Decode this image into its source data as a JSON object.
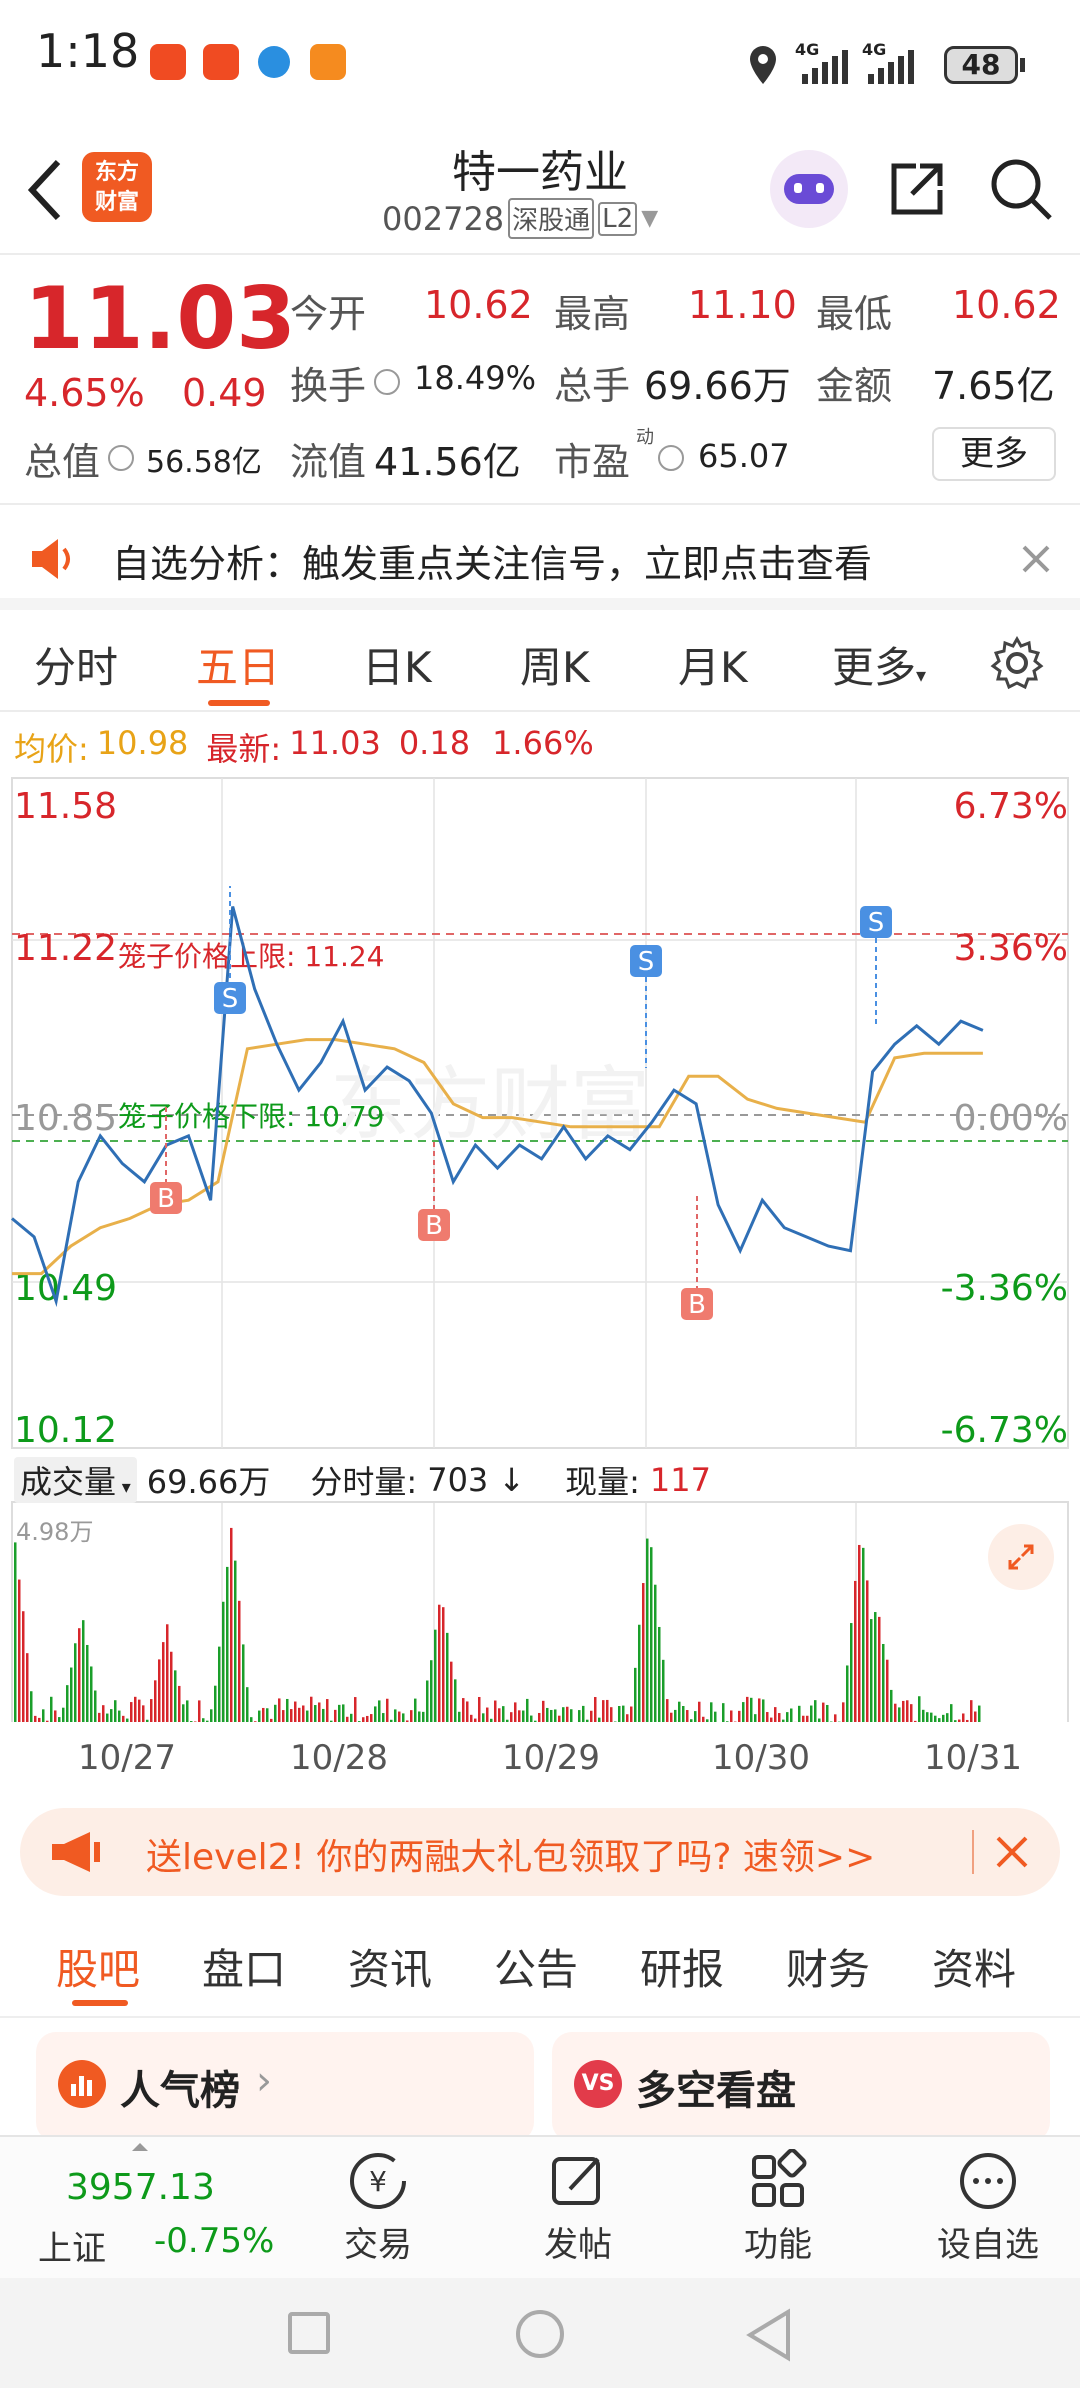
{
  "status": {
    "time": "1:18",
    "battery": "48",
    "net1": "4G",
    "net2": "4G"
  },
  "nav": {
    "title": "特一药业",
    "code": "002728",
    "badge": "深股通",
    "level": "L2",
    "logo_line1": "东方",
    "logo_line2": "财富"
  },
  "quote": {
    "price": "11.03",
    "pct": "4.65%",
    "chg": "0.49",
    "open_l": "今开",
    "open": "10.62",
    "high_l": "最高",
    "high": "11.10",
    "low_l": "最低",
    "low": "10.62",
    "turn_l": "换手",
    "turn": "18.49%",
    "vol_l": "总手",
    "vol": "69.66万",
    "amt_l": "金额",
    "amt": "7.65亿",
    "mcap_l": "总值",
    "mcap": "56.58亿",
    "float_l": "流值",
    "float": "41.56亿",
    "pe_l": "市盈",
    "pe_sup": "动",
    "pe": "65.07",
    "more": "更多"
  },
  "banner": {
    "text": "自选分析：触发重点关注信号，立即点击查看"
  },
  "tabs": [
    "分时",
    "五日",
    "日K",
    "周K",
    "月K",
    "更多"
  ],
  "legend": {
    "avg_l": "均价:",
    "avg": "10.98",
    "last_l": "最新:",
    "last": "11.03",
    "chg": "0.18",
    "pct": "1.66%"
  },
  "chart": {
    "left_ticks": [
      "11.58",
      "11.22",
      "10.85",
      "10.49",
      "10.12"
    ],
    "right_ticks": [
      "6.73%",
      "3.36%",
      "0.00%",
      "-3.36%",
      "-6.73%"
    ],
    "upper_label": "笼子价格上限:  11.24",
    "lower_label": "笼子价格下限:  10.79",
    "dates": [
      "10/27",
      "10/28",
      "10/29",
      "10/30",
      "10/31"
    ],
    "b_label": "B",
    "s_label": "S",
    "watermark": "东方财富"
  },
  "volume": {
    "label": "成交量",
    "total": "69.66万",
    "tick_l": "分时量:",
    "tick": "703",
    "tick_arrow": "↓",
    "cur_l": "现量:",
    "cur": "117",
    "max": "4.98万"
  },
  "promo": {
    "text": "送level2!  你的两融大礼包领取了吗?  速领>>"
  },
  "bottom_tabs": [
    "股吧",
    "盘口",
    "资讯",
    "公告",
    "研报",
    "财务",
    "资料"
  ],
  "cards": [
    {
      "title": "人气榜",
      "arrow": "›"
    },
    {
      "title": "多空看盘"
    }
  ],
  "toolbar": {
    "index_val": "3957.13",
    "index_name": "上证",
    "index_pct": "-0.75%",
    "items": [
      "交易",
      "发帖",
      "功能",
      "设自选"
    ]
  },
  "chart_data": {
    "type": "line",
    "title": "",
    "x_categories": [
      "10/27",
      "10/28",
      "10/29",
      "10/30",
      "10/31"
    ],
    "y_range": [
      10.12,
      11.58
    ],
    "pct_range": [
      "-6.73%",
      "6.73%"
    ],
    "series": [
      {
        "name": "最新",
        "values": [
          10.62,
          10.58,
          10.44,
          10.7,
          10.8,
          10.74,
          10.7,
          10.78,
          10.8,
          10.66,
          11.3,
          11.12,
          11.0,
          10.9,
          10.96,
          11.05,
          10.9,
          10.95,
          10.92,
          10.85,
          10.7,
          10.78,
          10.73,
          10.78,
          10.75,
          10.82,
          10.75,
          10.8,
          10.77,
          10.83,
          10.9,
          10.87,
          10.65,
          10.55,
          10.66,
          10.6,
          10.58,
          10.56,
          10.55,
          10.94,
          11.0,
          11.04,
          11.0,
          11.05,
          11.03
        ]
      },
      {
        "name": "均价",
        "values": [
          10.5,
          10.5,
          10.56,
          10.6,
          10.62,
          10.65,
          10.66,
          10.7,
          10.99,
          11.0,
          11.01,
          11.01,
          11.0,
          10.99,
          10.96,
          10.87,
          10.84,
          10.84,
          10.83,
          10.82,
          10.82,
          10.82,
          10.82,
          10.93,
          10.93,
          10.88,
          10.86,
          10.85,
          10.84,
          10.83,
          10.97,
          10.98,
          10.98,
          10.98
        ]
      }
    ]
  }
}
